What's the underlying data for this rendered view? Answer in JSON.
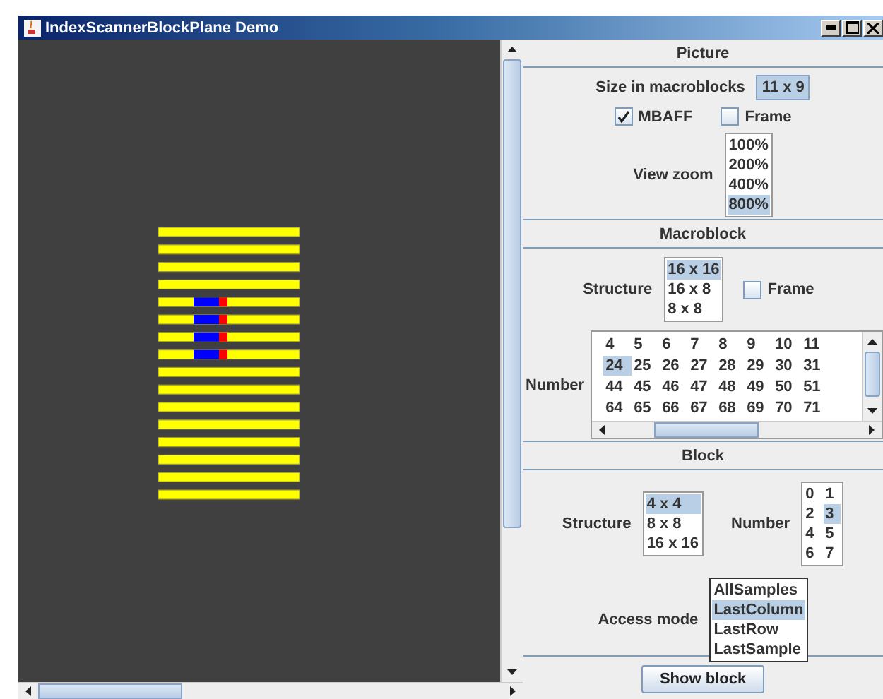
{
  "window": {
    "title": "IndexScannerBlockPlane Demo"
  },
  "picture": {
    "heading": "Picture",
    "size_label": "Size in macroblocks",
    "size_value": "11 x 9",
    "checkboxes": [
      {
        "label": "MBAFF",
        "checked": true
      },
      {
        "label": "Frame",
        "checked": false
      }
    ],
    "zoom_label": "View zoom",
    "zoom_options": [
      {
        "label": "100%",
        "selected": false
      },
      {
        "label": "200%",
        "selected": false
      },
      {
        "label": "400%",
        "selected": false
      },
      {
        "label": "800%",
        "selected": true
      }
    ]
  },
  "macroblock": {
    "heading": "Macroblock",
    "structure_label": "Structure",
    "structure_options": [
      {
        "label": "16 x 16",
        "selected": true
      },
      {
        "label": "16 x 8",
        "selected": false
      },
      {
        "label": "8 x 8",
        "selected": false
      }
    ],
    "frame": {
      "label": "Frame",
      "checked": false
    },
    "number_label": "Number",
    "number_rows": [
      [
        {
          "label": "4",
          "selected": false
        },
        {
          "label": "5",
          "selected": false
        },
        {
          "label": "6",
          "selected": false
        },
        {
          "label": "7",
          "selected": false
        },
        {
          "label": "8",
          "selected": false
        },
        {
          "label": "9",
          "selected": false
        },
        {
          "label": "10",
          "selected": false
        },
        {
          "label": "11",
          "selected": false
        }
      ],
      [
        {
          "label": "24",
          "selected": true
        },
        {
          "label": "25",
          "selected": false
        },
        {
          "label": "26",
          "selected": false
        },
        {
          "label": "27",
          "selected": false
        },
        {
          "label": "28",
          "selected": false
        },
        {
          "label": "29",
          "selected": false
        },
        {
          "label": "30",
          "selected": false
        },
        {
          "label": "31",
          "selected": false
        }
      ],
      [
        {
          "label": "44",
          "selected": false
        },
        {
          "label": "45",
          "selected": false
        },
        {
          "label": "46",
          "selected": false
        },
        {
          "label": "47",
          "selected": false
        },
        {
          "label": "48",
          "selected": false
        },
        {
          "label": "49",
          "selected": false
        },
        {
          "label": "50",
          "selected": false
        },
        {
          "label": "51",
          "selected": false
        }
      ],
      [
        {
          "label": "64",
          "selected": false
        },
        {
          "label": "65",
          "selected": false
        },
        {
          "label": "66",
          "selected": false
        },
        {
          "label": "67",
          "selected": false
        },
        {
          "label": "68",
          "selected": false
        },
        {
          "label": "69",
          "selected": false
        },
        {
          "label": "70",
          "selected": false
        },
        {
          "label": "71",
          "selected": false
        }
      ]
    ]
  },
  "block": {
    "heading": "Block",
    "structure_label": "Structure",
    "structure_options": [
      {
        "label": "4 x 4",
        "selected": true
      },
      {
        "label": "8 x 8",
        "selected": false
      },
      {
        "label": "16 x 16",
        "selected": false
      }
    ],
    "number_label": "Number",
    "number_options": [
      {
        "label": "0",
        "selected": false
      },
      {
        "label": "1",
        "selected": false
      },
      {
        "label": "2",
        "selected": false
      },
      {
        "label": "3",
        "selected": true
      },
      {
        "label": "4",
        "selected": false
      },
      {
        "label": "5",
        "selected": false
      },
      {
        "label": "6",
        "selected": false
      },
      {
        "label": "7",
        "selected": false
      }
    ],
    "access_label": "Access mode",
    "access_options": [
      {
        "label": "AllSamples",
        "selected": false
      },
      {
        "label": "LastColumn",
        "selected": true
      },
      {
        "label": "LastRow",
        "selected": false
      },
      {
        "label": "LastSample",
        "selected": false
      }
    ]
  },
  "show_button": "Show block"
}
